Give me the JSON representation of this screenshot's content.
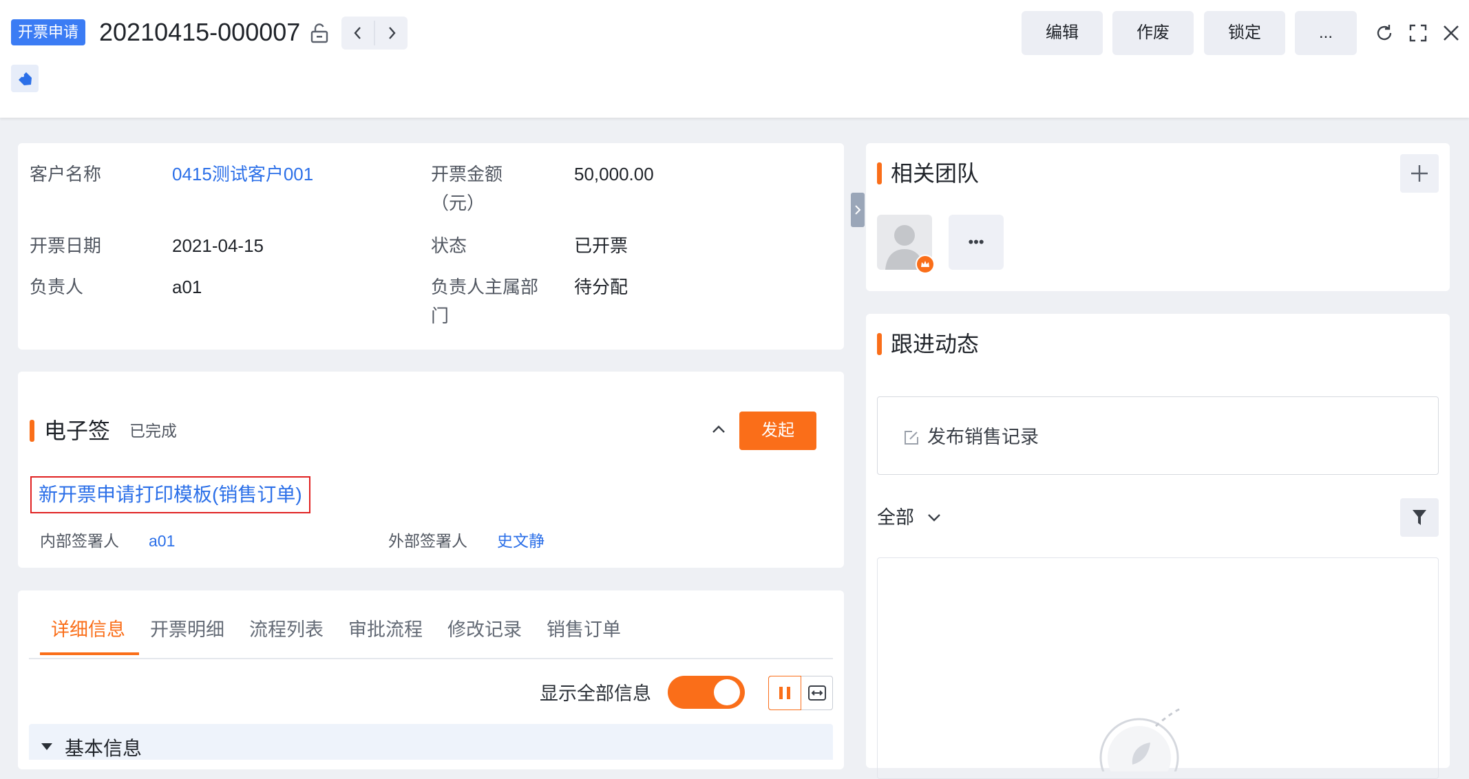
{
  "header": {
    "object_type": "开票申请",
    "record_id": "20210415-000007",
    "buttons": {
      "edit": "编辑",
      "void": "作废",
      "lock": "锁定",
      "more": "..."
    }
  },
  "summary": {
    "fields": [
      {
        "label": "客户名称",
        "value": "0415测试客户001"
      },
      {
        "label": "开票金额（元）",
        "value": "50,000.00"
      },
      {
        "label": "开票日期",
        "value": "2021-04-15"
      },
      {
        "label": "状态",
        "value": "已开票"
      },
      {
        "label": "负责人",
        "value": "a01"
      },
      {
        "label": "负责人主属部门",
        "value": "待分配"
      }
    ]
  },
  "esign": {
    "title": "电子签",
    "status": "已完成",
    "launch_label": "发起",
    "template_name": "新开票申请打印模板(销售订单)",
    "internal_signer_label": "内部签署人",
    "internal_signer": "a01",
    "external_signer_label": "外部签署人",
    "external_signer": "史文静"
  },
  "tabs": [
    "详细信息",
    "开票明细",
    "流程列表",
    "审批流程",
    "修改记录",
    "销售订单"
  ],
  "detail": {
    "show_all_label": "显示全部信息",
    "show_all_on": true,
    "section_basic": "基本信息"
  },
  "team": {
    "title": "相关团队",
    "more": "•••"
  },
  "followup": {
    "title": "跟进动态",
    "publish_label": "发布销售记录",
    "filter_value": "全部"
  },
  "colors": {
    "accent": "#fa6e19",
    "link": "#2b6fe8",
    "badge": "#3b7cf4"
  },
  "icons": [
    "unlock-icon",
    "chevron-left-icon",
    "chevron-right-icon",
    "tag-icon",
    "refresh-icon",
    "fullscreen-icon",
    "close-icon",
    "plus-icon",
    "avatar-icon",
    "crown-icon",
    "collapse-panel-icon",
    "chevron-up-icon",
    "edit-icon",
    "chevron-down-icon",
    "filter-icon",
    "pause-icon",
    "fit-width-icon",
    "caret-down-icon"
  ]
}
